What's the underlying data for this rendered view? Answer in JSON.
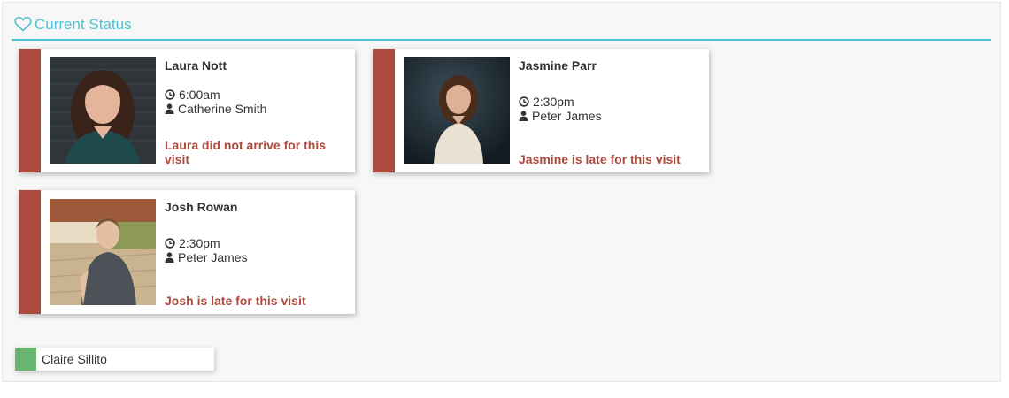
{
  "panel": {
    "title": "Current Status",
    "title_icon": "heart-outline-icon",
    "accent_color": "#4ec3d3"
  },
  "cards": [
    {
      "name": "Laura Nott",
      "time": "6:00am",
      "carer": "Catherine Smith",
      "status": "Laura did not arrive for this visit",
      "status_color": "#ad4a3e",
      "stripe_color": "#ad4a3e",
      "time_icon": "clock-icon",
      "carer_icon": "user-icon"
    },
    {
      "name": "Jasmine Parr",
      "time": "2:30pm",
      "carer": "Peter James",
      "status": "Jasmine is late for this visit",
      "status_color": "#ad4a3e",
      "stripe_color": "#ad4a3e",
      "time_icon": "clock-icon",
      "carer_icon": "user-icon"
    },
    {
      "name": "Josh Rowan",
      "time": "2:30pm",
      "carer": "Peter James",
      "status": "Josh is late for this visit",
      "status_color": "#ad4a3e",
      "stripe_color": "#ad4a3e",
      "time_icon": "clock-icon",
      "carer_icon": "user-icon"
    }
  ],
  "legend": [
    {
      "label": "Claire Sillito",
      "color": "#6ab56f"
    }
  ]
}
